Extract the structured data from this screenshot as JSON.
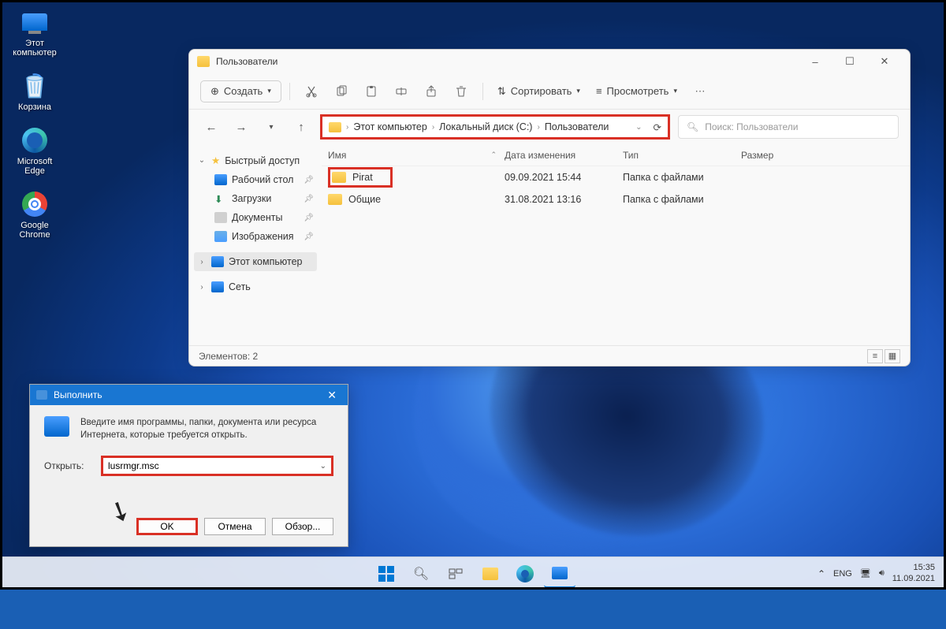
{
  "desktop": {
    "icons": [
      {
        "label": "Этот\nкомпьютер"
      },
      {
        "label": "Корзина"
      },
      {
        "label": "Microsoft\nEdge"
      },
      {
        "label": "Google\nChrome"
      }
    ]
  },
  "explorer": {
    "title": "Пользователи",
    "toolbar": {
      "new_label": "Создать",
      "sort_label": "Сортировать",
      "view_label": "Просмотреть"
    },
    "breadcrumb": {
      "crumb0": "Этот компьютер",
      "crumb1": "Локальный диск (C:)",
      "crumb2": "Пользователи"
    },
    "search_placeholder": "Поиск: Пользователи",
    "sidebar": {
      "quick": "Быстрый доступ",
      "desktop": "Рабочий стол",
      "downloads": "Загрузки",
      "documents": "Документы",
      "pictures": "Изображения",
      "this_pc": "Этот компьютер",
      "network": "Сеть"
    },
    "columns": {
      "name": "Имя",
      "date": "Дата изменения",
      "type": "Тип",
      "size": "Размер"
    },
    "rows": [
      {
        "name": "Pirat",
        "date": "09.09.2021 15:44",
        "type": "Папка с файлами",
        "size": ""
      },
      {
        "name": "Общие",
        "date": "31.08.2021 13:16",
        "type": "Папка с файлами",
        "size": ""
      }
    ],
    "status": "Элементов: 2"
  },
  "run": {
    "title": "Выполнить",
    "desc": "Введите имя программы, папки, документа или ресурса Интернета, которые требуется открыть.",
    "open_label": "Открыть:",
    "value": "lusrmgr.msc",
    "ok": "OK",
    "cancel": "Отмена",
    "browse": "Обзор..."
  },
  "taskbar": {
    "lang": "ENG",
    "time": "15:35",
    "date": "11.09.2021"
  }
}
